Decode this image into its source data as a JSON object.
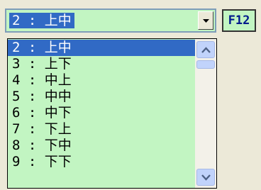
{
  "combo": {
    "selected_value": "2 : 上中"
  },
  "shortcut": {
    "label": "F12"
  },
  "list": {
    "items": [
      {
        "label": "2 : 上中",
        "selected": true
      },
      {
        "label": "3 : 上下"
      },
      {
        "label": "4 : 中上"
      },
      {
        "label": "5 : 中中"
      },
      {
        "label": "6 : 中下"
      },
      {
        "label": "7 : 下上"
      },
      {
        "label": "8 : 下中"
      },
      {
        "label": "9 : 下下"
      }
    ]
  },
  "icons": {
    "dropdown": "chevron-down-icon",
    "scroll_up": "scroll-up-arrow-icon",
    "scroll_down": "scroll-down-arrow-icon"
  },
  "colors": {
    "field_background": "#c2f5c2",
    "selection": "#316ac5",
    "shortcut_text": "#001a8c"
  }
}
